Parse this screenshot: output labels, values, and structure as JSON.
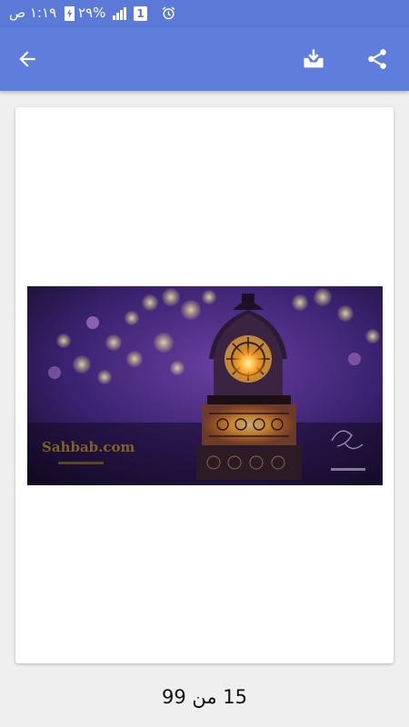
{
  "status_bar": {
    "time": "١:١٩ ص",
    "battery_percent": "٢٩%",
    "sim_slot": "1",
    "icons": [
      "alarm-icon",
      "sim-icon",
      "signal-icon",
      "battery-charging-icon"
    ]
  },
  "toolbar": {
    "icons": [
      "back-arrow-icon",
      "download-icon",
      "share-icon"
    ],
    "color": "#5f7edb"
  },
  "image": {
    "watermark_left": "Sahbab.com",
    "description_icons": [
      "lantern-illustration"
    ]
  },
  "pager": {
    "current": "15",
    "separator": "من",
    "total": "99"
  }
}
